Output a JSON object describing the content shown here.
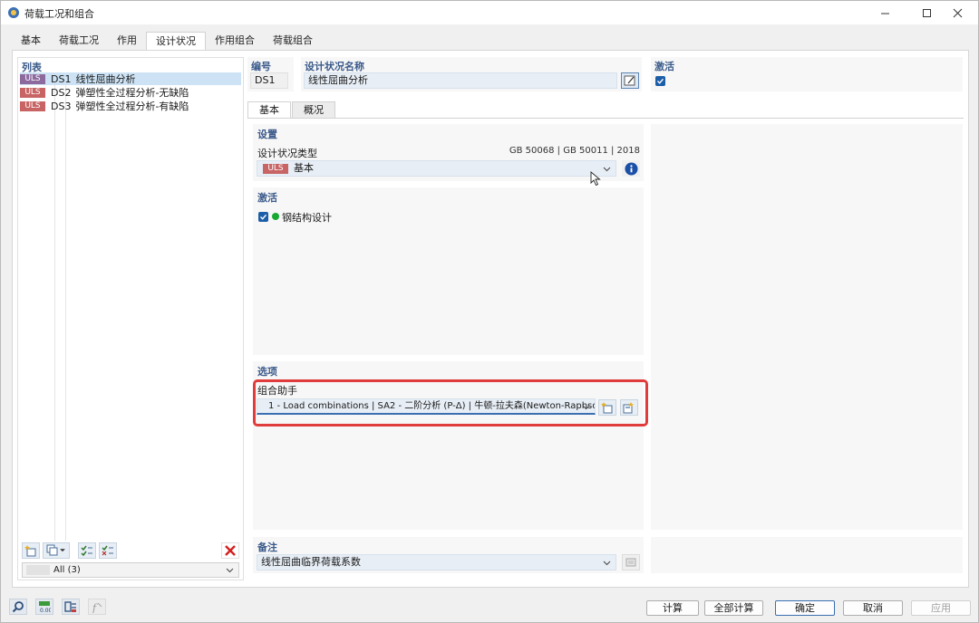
{
  "window": {
    "title": "荷载工况和组合"
  },
  "tabs": [
    "基本",
    "荷载工况",
    "作用",
    "设计状况",
    "作用组合",
    "荷载组合"
  ],
  "list": {
    "title": "列表",
    "items": [
      {
        "badge": "ULS",
        "id": "DS1",
        "name": "线性屈曲分析"
      },
      {
        "badge": "ULS",
        "id": "DS2",
        "name": "弹塑性全过程分析-无缺陷"
      },
      {
        "badge": "ULS",
        "id": "DS3",
        "name": "弹塑性全过程分析-有缺陷"
      }
    ],
    "filter": "All (3)"
  },
  "header": {
    "number_label": "编号",
    "number_value": "DS1",
    "name_label": "设计状况名称",
    "name_value": "线性屈曲分析",
    "active_label": "激活"
  },
  "inner_tabs": [
    "基本",
    "概况"
  ],
  "settings": {
    "title": "设置",
    "type_label": "设计状况类型",
    "standard": "GB 50068 | GB 50011 | 2018",
    "type_badge": "ULS",
    "type_value": "基本"
  },
  "activation": {
    "title": "激活",
    "item": "钢结构设计"
  },
  "options": {
    "title": "选项",
    "assistant_label": "组合助手",
    "assistant_value": "1 - Load combinations | SA2 - 二阶分析 (P-Δ) | 牛顿-拉夫森(Newton-Raphso..."
  },
  "comment": {
    "title": "备注",
    "value": "线性屈曲临界荷载系数"
  },
  "footer": {
    "calc": "计算",
    "calc_all": "全部计算",
    "ok": "确定",
    "cancel": "取消",
    "apply": "应用"
  },
  "colors": {
    "uls_badge": "#c86464",
    "accent": "#1d5ea8",
    "highlight": "#e03c3c",
    "active_dot": "#1aa834"
  }
}
